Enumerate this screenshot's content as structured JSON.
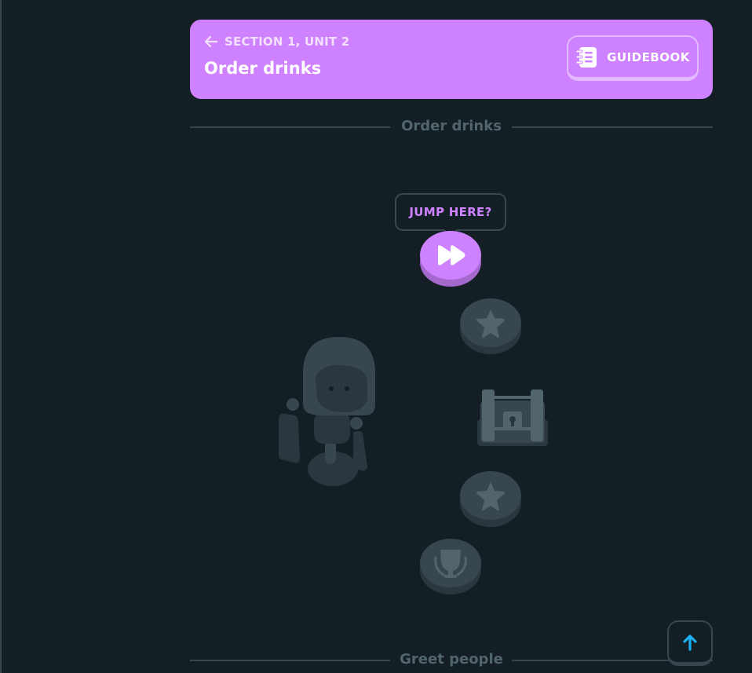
{
  "unit_header": {
    "section_label": "SECTION 1, UNIT 2",
    "title": "Order drinks",
    "guidebook_label": "GUIDEBOOK",
    "color": "#ce82ff"
  },
  "dividers": [
    {
      "label": "Order drinks"
    },
    {
      "label": "Greet people"
    }
  ],
  "path": {
    "jump_tooltip": "JUMP HERE?",
    "nodes": [
      {
        "kind": "fast-forward",
        "state": "active",
        "color": "#ce82ff",
        "icon": "fast-forward-icon"
      },
      {
        "kind": "lesson",
        "state": "locked",
        "icon": "star-icon"
      },
      {
        "kind": "chest",
        "state": "locked",
        "icon": "treasure-chest-icon"
      },
      {
        "kind": "lesson",
        "state": "locked",
        "icon": "star-icon"
      },
      {
        "kind": "unit-review",
        "state": "locked",
        "icon": "trophy-icon"
      }
    ]
  },
  "colors": {
    "background": "#131f24",
    "locked_node": "#37464f",
    "locked_icon": "#52656d",
    "scroll_arrow": "#1cb0f6"
  },
  "scroll_top": {
    "icon": "arrow-up-icon"
  }
}
